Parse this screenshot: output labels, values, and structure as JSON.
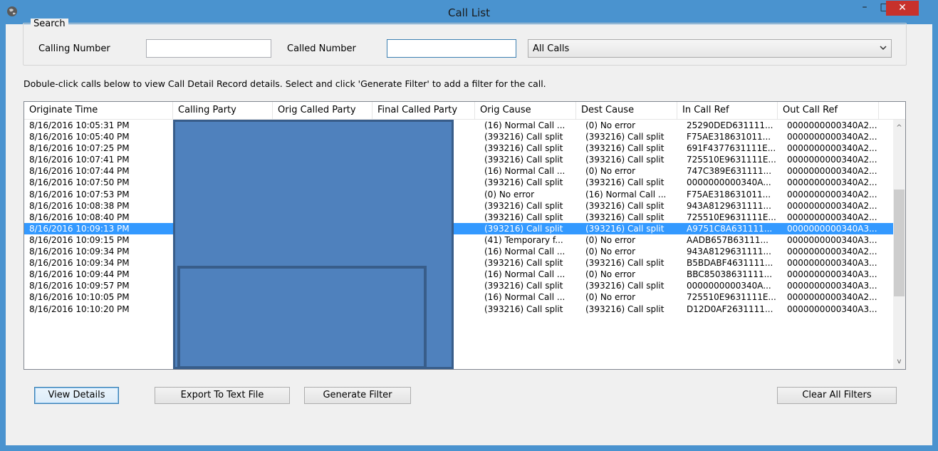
{
  "window": {
    "title": "Call List",
    "controls": {
      "minimize": "–",
      "maximize": "□",
      "close": "✕"
    }
  },
  "search": {
    "group_title": "Search",
    "calling_label": "Calling Number",
    "calling_value": "",
    "called_label": "Called Number",
    "called_value": "",
    "filter_selected": "All Calls"
  },
  "instruction": "Dobule-click calls below to view Call Detail Record details. Select and click 'Generate Filter' to add a filter for the call.",
  "table": {
    "columns": [
      "Originate Time",
      "Calling Party",
      "Orig Called Party",
      "Final Called Party",
      "Orig Cause",
      "Dest Cause",
      "In Call Ref",
      "Out Call Ref"
    ],
    "selected_index": 9,
    "rows": [
      [
        "8/16/2016 10:05:31 PM",
        "(16) Normal Call ...",
        "(0) No error",
        "25290DED631111...",
        "0000000000340A2..."
      ],
      [
        "8/16/2016 10:05:40 PM",
        "(393216) Call split",
        "(393216) Call split",
        "F75AE318631011...",
        "0000000000340A2..."
      ],
      [
        "8/16/2016 10:07:25 PM",
        "(393216) Call split",
        "(393216) Call split",
        "691F4377631111E...",
        "0000000000340A2..."
      ],
      [
        "8/16/2016 10:07:41 PM",
        "(393216) Call split",
        "(393216) Call split",
        "725510E9631111E...",
        "0000000000340A2..."
      ],
      [
        "8/16/2016 10:07:44 PM",
        "(16) Normal Call ...",
        "(0) No error",
        "747C389E631111...",
        "0000000000340A2..."
      ],
      [
        "8/16/2016 10:07:50 PM",
        "(393216) Call split",
        "(393216) Call split",
        "0000000000340A...",
        "0000000000340A2..."
      ],
      [
        "8/16/2016 10:07:53 PM",
        "(0) No error",
        "(16) Normal Call ...",
        "F75AE318631011...",
        "0000000000340A2..."
      ],
      [
        "8/16/2016 10:08:38 PM",
        "(393216) Call split",
        "(393216) Call split",
        "943A8129631111...",
        "0000000000340A2..."
      ],
      [
        "8/16/2016 10:08:40 PM",
        "(393216) Call split",
        "(393216) Call split",
        "725510E9631111E...",
        "0000000000340A2..."
      ],
      [
        "8/16/2016 10:09:13 PM",
        "(393216) Call split",
        "(393216) Call split",
        "A9751C8A631111...",
        "0000000000340A3..."
      ],
      [
        "8/16/2016 10:09:15 PM",
        "(41) Temporary f...",
        "(0) No error",
        "AADB657B63111...",
        "0000000000340A3..."
      ],
      [
        "8/16/2016 10:09:34 PM",
        "(16) Normal Call ...",
        "(0) No error",
        "943A8129631111...",
        "0000000000340A2..."
      ],
      [
        "8/16/2016 10:09:34 PM",
        "(393216) Call split",
        "(393216) Call split",
        "B5BDABF4631111...",
        "0000000000340A3..."
      ],
      [
        "8/16/2016 10:09:44 PM",
        "(16) Normal Call ...",
        "(0) No error",
        "BBC85038631111...",
        "0000000000340A3..."
      ],
      [
        "8/16/2016 10:09:57 PM",
        "(393216) Call split",
        "(393216) Call split",
        "0000000000340A...",
        "0000000000340A3..."
      ],
      [
        "8/16/2016 10:10:05 PM",
        "(16) Normal Call ...",
        "(0) No error",
        "725510E9631111E...",
        "0000000000340A2..."
      ],
      [
        "8/16/2016 10:10:20 PM",
        "(393216) Call split",
        "(393216) Call split",
        "D12D0AF2631111...",
        "0000000000340A3..."
      ]
    ]
  },
  "buttons": {
    "view_details": "View Details",
    "export": "Export To Text File",
    "generate_filter": "Generate Filter",
    "clear_filters": "Clear All Filters"
  },
  "scrollbar": {
    "up": "^",
    "down": "v"
  },
  "colors": {
    "titlebar": "#4a93cf",
    "selection": "#3399ff",
    "close": "#c7312b",
    "redaction": "#4f81bd"
  }
}
